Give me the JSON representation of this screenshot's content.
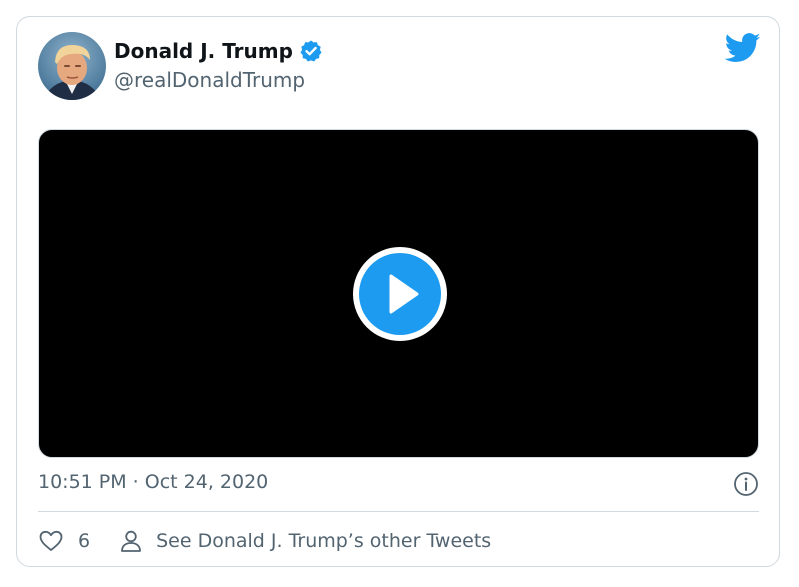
{
  "tweet": {
    "author": {
      "name": "Donald J. Trump",
      "handle": "@realDonaldTrump",
      "verified": true,
      "avatar": "profile-photo"
    },
    "logo": "twitter-bird-icon",
    "media": {
      "type": "video",
      "control": "play-icon"
    },
    "timestamp": "10:51 PM · Oct 24, 2020",
    "info_icon": "info-icon",
    "likes": {
      "icon": "heart-icon",
      "count": "6"
    },
    "profile_link": {
      "icon": "person-icon",
      "label": "See Donald J. Trump’s other Tweets"
    }
  },
  "colors": {
    "accent": "#1d9bf0",
    "text_primary": "#0f1419",
    "text_secondary": "#536471",
    "border": "#cfd9de",
    "video_background": "#000000"
  }
}
